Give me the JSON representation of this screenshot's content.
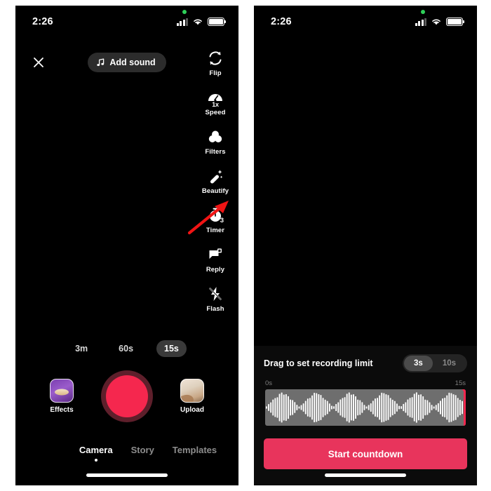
{
  "status_bar": {
    "time": "2:26",
    "icons": [
      "privacy-dot",
      "cellular-signal",
      "wifi",
      "battery"
    ]
  },
  "left_screen": {
    "name": "tiktok-camera",
    "close_icon": "close-icon",
    "add_sound": {
      "label": "Add sound",
      "icon": "music-note-icon"
    },
    "tools": [
      {
        "label": "Flip",
        "icon": "flip-camera-icon",
        "badge": ""
      },
      {
        "label": "Speed",
        "icon": "speedometer-icon",
        "badge": "1x"
      },
      {
        "label": "Filters",
        "icon": "filters-icon",
        "badge": ""
      },
      {
        "label": "Beautify",
        "icon": "magic-wand-icon",
        "badge": ""
      },
      {
        "label": "Timer",
        "icon": "stopwatch-icon",
        "badge": "3"
      },
      {
        "label": "Reply",
        "icon": "reply-flag-icon",
        "badge": ""
      },
      {
        "label": "Flash",
        "icon": "flash-off-icon",
        "badge": ""
      }
    ],
    "annotation": {
      "type": "arrow",
      "color": "#f01414",
      "points_to": "Timer"
    },
    "durations": [
      {
        "label": "3m",
        "selected": false
      },
      {
        "label": "60s",
        "selected": false
      },
      {
        "label": "15s",
        "selected": true
      }
    ],
    "effects": {
      "label": "Effects",
      "icon": "effects-thumbnail"
    },
    "record": {
      "name": "record-button",
      "color": "#f5274e",
      "ring_color": "#5e1f2b"
    },
    "upload": {
      "label": "Upload",
      "icon": "upload-thumbnail"
    },
    "tabs": [
      {
        "label": "Camera",
        "active": true
      },
      {
        "label": "Story",
        "active": false
      },
      {
        "label": "Templates",
        "active": false
      }
    ]
  },
  "right_screen": {
    "name": "tiktok-timer-sheet",
    "sheet_title": "Drag to set recording limit",
    "countdown_options": [
      {
        "label": "3s",
        "selected": true
      },
      {
        "label": "10s",
        "selected": false
      }
    ],
    "scale": {
      "start": "0s",
      "end": "15s"
    },
    "waveform": {
      "track_color": "#6e6e6e",
      "bar_color": "#ffffff",
      "handle_color": "#f5274e",
      "handle_position": "15s"
    },
    "cta": {
      "label": "Start countdown",
      "color": "#e8345c"
    }
  }
}
